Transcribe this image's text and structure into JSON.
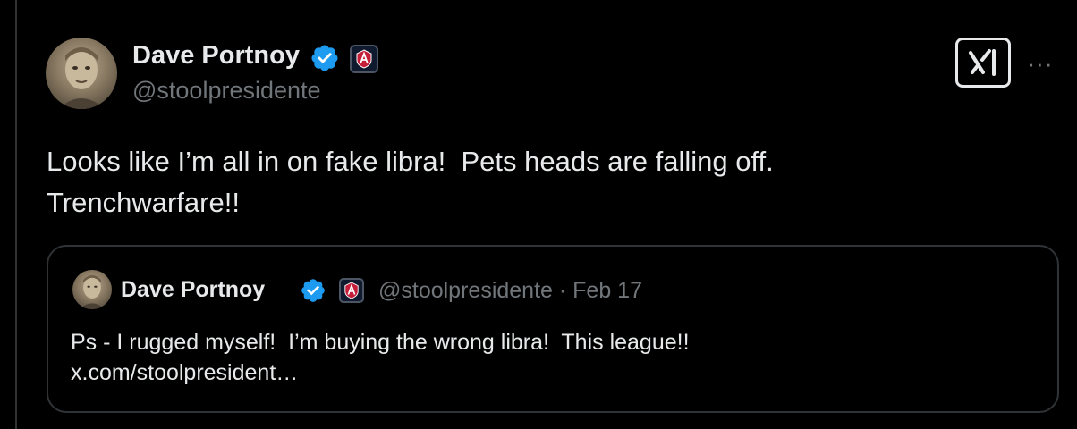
{
  "author": {
    "display_name": "Dave Portnoy",
    "handle": "@stoolpresidente"
  },
  "actions": {
    "grok_icon": "grok-x-icon",
    "more_label": "···"
  },
  "tweet": {
    "lines": [
      "Looks like I’m all in on fake libra!  Pets heads are falling off.",
      "Trenchwarfare!!"
    ]
  },
  "quoted": {
    "display_name": "Dave Portnoy",
    "meta": "@stoolpresidente · Feb 17",
    "lines": [
      "Ps - I rugged myself!  I’m buying the wrong libra!  This league!!",
      "x.com/stoolpresident…"
    ]
  },
  "colors": {
    "background": "#000000",
    "text_primary": "#e7e9ea",
    "text_secondary": "#71767b",
    "verified_blue": "#1d9bf0",
    "border": "#2f3336"
  }
}
